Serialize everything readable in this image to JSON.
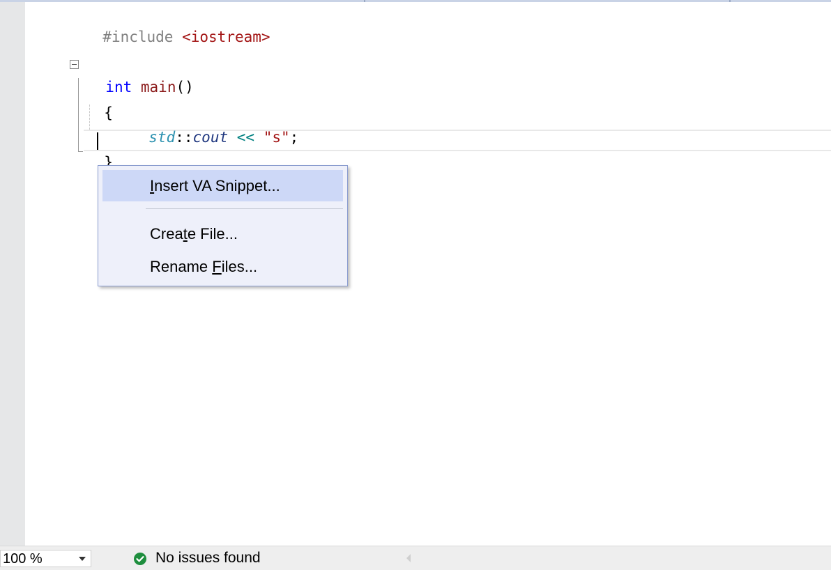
{
  "code": {
    "line1": {
      "directive": "#include",
      "space": " ",
      "header": "<iostream>"
    },
    "line2": {
      "keyword": "int",
      "space": " ",
      "func": "main",
      "parens": "()"
    },
    "line3": {
      "text": "{"
    },
    "line4": {
      "ns": "std",
      "scope": "::",
      "var": "cout",
      "op": "<<",
      "str": "\"s\"",
      "semi": ";"
    },
    "line5": {
      "text": "}"
    }
  },
  "context_menu": {
    "items": [
      {
        "pre": "",
        "mnemonic": "I",
        "post": "nsert VA Snippet...",
        "highlighted": true
      },
      {
        "pre": "Crea",
        "mnemonic": "t",
        "post": "e File...",
        "highlighted": false
      },
      {
        "pre": "Rename ",
        "mnemonic": "F",
        "post": "iles...",
        "highlighted": false
      }
    ]
  },
  "status": {
    "zoom": "100 %",
    "issues": "No issues found"
  },
  "colors": {
    "keyword": "#0000ff",
    "string": "#a31515",
    "preprocessor": "#808080",
    "namespace": "#2b91af",
    "menu_highlight": "#cdd8f7",
    "success": "#1e8e3e"
  }
}
